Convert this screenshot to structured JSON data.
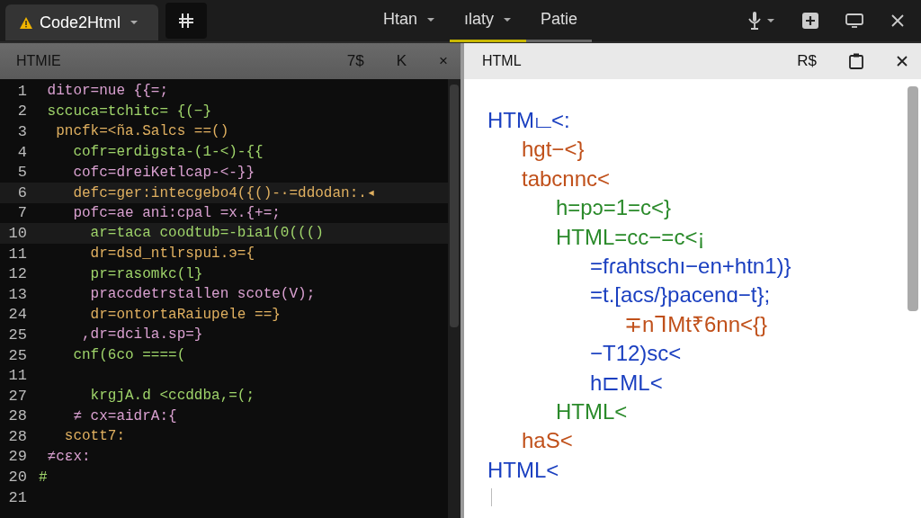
{
  "app_tab": {
    "title": "Code2Html"
  },
  "menus": [
    {
      "label": "Htan",
      "dropdown": true,
      "selected": false,
      "hovered": false
    },
    {
      "label": "ılaty",
      "dropdown": true,
      "selected": true,
      "hovered": false
    },
    {
      "label": "Patie",
      "dropdown": false,
      "selected": false,
      "hovered": true
    }
  ],
  "left_pane": {
    "title": "HTMIE",
    "actions": [
      "7$",
      "K",
      "×"
    ],
    "lines": [
      {
        "number": "1",
        "code": " ditor=nue {{=;",
        "highlighted": false
      },
      {
        "number": "2",
        "code": " sccuca=tchitc= {(−}",
        "highlighted": false
      },
      {
        "number": "3",
        "code": "  pncfk=<ña.Salcs ==()",
        "highlighted": false
      },
      {
        "number": "4",
        "code": "    cofr=erdigsta-(1-<)-{{",
        "highlighted": false
      },
      {
        "number": "5",
        "code": "    cofc=dreiKetlcap-<-}}",
        "highlighted": false
      },
      {
        "number": "6",
        "code": "    defc=ger:intecgebo4({()-·=ddodan:.◂",
        "highlighted": true
      },
      {
        "number": "7",
        "code": "    pofc=ae ani:cpal =x.{+=;",
        "highlighted": false
      },
      {
        "number": "10",
        "code": "      ar=taca coodtub=-bia1(0((()",
        "highlighted": true
      },
      {
        "number": "11",
        "code": "      dr=dsd_ntlrspui.э={",
        "highlighted": false
      },
      {
        "number": "12",
        "code": "      pr=rasomkc(l}",
        "highlighted": false
      },
      {
        "number": "13",
        "code": "      praccdetrstallen scote(V);",
        "highlighted": false
      },
      {
        "number": "24",
        "code": "      dr=ontortaRaiupele ==}",
        "highlighted": false
      },
      {
        "number": "25",
        "code": "     ,dr=dcila.sp=}",
        "highlighted": false
      },
      {
        "number": "25",
        "code": "    cnf(6co ====(",
        "highlighted": false
      },
      {
        "number": "11",
        "highlighted": false
      },
      {
        "number": "27",
        "code": "      krgjA.d <ccddba,=(;",
        "highlighted": false
      },
      {
        "number": "28",
        "code": "    ≠ cx=aidrA:{",
        "highlighted": false
      },
      {
        "number": "28",
        "code": "   scott7:",
        "highlighted": false
      },
      {
        "number": "29",
        "code": " ≠cɛx:",
        "highlighted": false
      },
      {
        "number": "20",
        "code": "#",
        "highlighted": false
      },
      {
        "number": "21",
        "highlighted": false
      }
    ]
  },
  "right_pane": {
    "title": "HTML",
    "actions": [
      "R$"
    ],
    "tree": [
      {
        "text": "HTMட<:",
        "children": [
          {
            "text": "hgt−<}"
          },
          {
            "text": "tabcnnc<",
            "children": [
              {
                "text": "h=pɔ=1=c<}"
              },
              {
                "text": "HTML=cc−=c<¡",
                "children": [
                  {
                    "text": "=fɾahtschı−en+htn1)}"
                  },
                  {
                    "text": "=t.[acs/}pacenɑ−t};",
                    "children": [
                      {
                        "text": "∓nᒣMt₹6nn<{}"
                      }
                    ]
                  },
                  {
                    "text": "−T12)sc<"
                  },
                  {
                    "text": "h⊏ML<"
                  }
                ]
              },
              {
                "text": "HTML<"
              }
            ]
          },
          {
            "text": "haS<"
          }
        ]
      },
      {
        "text": "HTML<"
      }
    ]
  }
}
